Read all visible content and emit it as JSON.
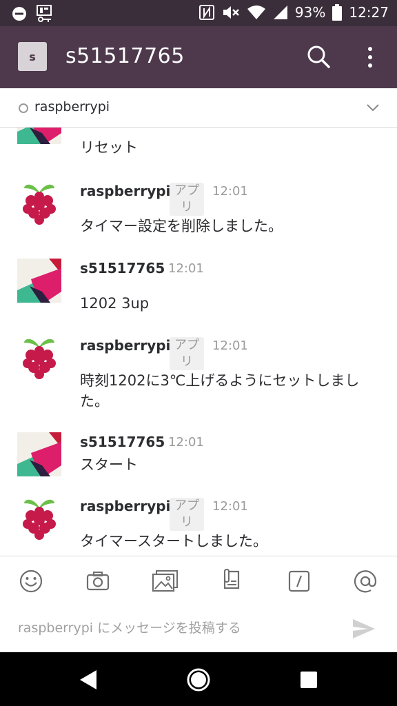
{
  "status_bar": {
    "battery": "93%",
    "time": "12:27",
    "icons": [
      "minus-circle-icon",
      "sim-key-icon",
      "nfc-icon",
      "mute-icon",
      "wifi-icon",
      "signal-icon",
      "battery-icon"
    ]
  },
  "app_bar": {
    "team_initial": "s",
    "title": "s51517765",
    "icons": [
      "search-icon",
      "more-vert-icon"
    ]
  },
  "channel": {
    "name": "raspberrypi",
    "icons": [
      "presence-icon",
      "chevron-down-icon"
    ]
  },
  "messages": [
    {
      "avatar": "slack-logo-avatar",
      "sender": "",
      "badge": "",
      "time": "",
      "text": "リセット"
    },
    {
      "avatar": "raspberry-avatar",
      "sender": "raspberrypi",
      "badge": "アプリ",
      "time": "12:01",
      "text": "タイマー設定を削除しました。"
    },
    {
      "avatar": "slack-logo-avatar",
      "sender": "s51517765",
      "badge": "",
      "time": "12:01",
      "text": "1202 3up"
    },
    {
      "avatar": "raspberry-avatar",
      "sender": "raspberrypi",
      "badge": "アプリ",
      "time": "12:01",
      "text": "時刻1202に3℃上げるようにセットしました。"
    },
    {
      "avatar": "slack-logo-avatar",
      "sender": "s51517765",
      "badge": "",
      "time": "12:01",
      "text": "スタート"
    },
    {
      "avatar": "raspberry-avatar",
      "sender": "raspberrypi",
      "badge": "アプリ",
      "time": "12:01",
      "text": "タイマースタートしました。"
    }
  ],
  "toolbar": {
    "icons": [
      "emoji-icon",
      "camera-icon",
      "gallery-icon",
      "file-icon",
      "slash-command-icon",
      "mention-icon"
    ]
  },
  "compose": {
    "placeholder": "raspberrypi にメッセージを投稿する",
    "send_icon": "send-icon"
  },
  "nav_bar": {
    "icons": [
      "back-icon",
      "home-icon",
      "recents-icon"
    ]
  },
  "colors": {
    "status_bar_bg": "#3b2e3b",
    "app_bar_bg": "#4d394b",
    "raspberry_red": "#c51a4a",
    "leaf_green": "#6cc04a",
    "meta_gray": "#9a9a9a"
  }
}
